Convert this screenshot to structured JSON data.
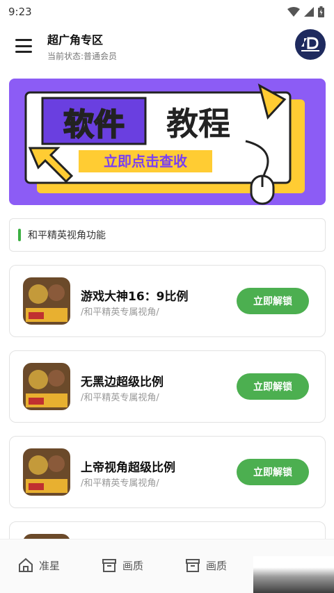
{
  "status": {
    "time": "9:23"
  },
  "header": {
    "title": "超广角专区",
    "subtitle": "当前状态:普通会员"
  },
  "banner": {
    "word1": "软件",
    "word2": "教程",
    "cta": "立即点击查收"
  },
  "section": {
    "label": "和平精英视角功能"
  },
  "cards": [
    {
      "title": "游戏大神16：9比例",
      "subtitle": "/和平精英专属视角/",
      "button": "立即解锁"
    },
    {
      "title": "无黑边超级比例",
      "subtitle": "/和平精英专属视角/",
      "button": "立即解锁"
    },
    {
      "title": "上帝视角超级比例",
      "subtitle": "/和平精英专属视角/",
      "button": "立即解锁"
    }
  ],
  "bottom_nav": [
    {
      "label": "准星",
      "icon": "home-icon"
    },
    {
      "label": "画质",
      "icon": "archive-box-icon"
    },
    {
      "label": "画质",
      "icon": "archive-box-icon"
    }
  ],
  "colors": {
    "accent_green": "#4caf50",
    "banner_purple": "#8c5cf5",
    "banner_yellow": "#ffcc33"
  }
}
